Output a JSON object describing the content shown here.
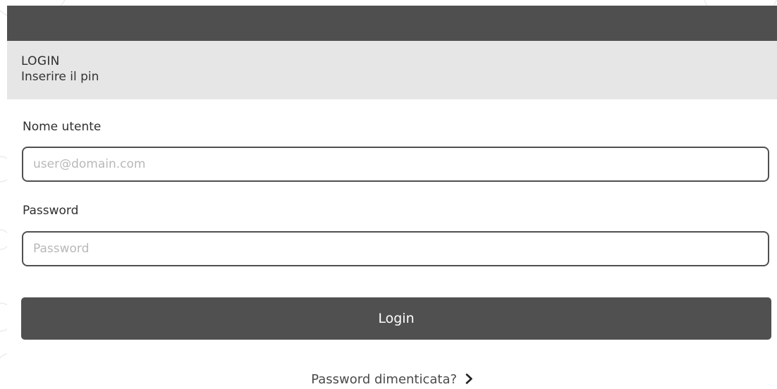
{
  "header": {
    "title": "LOGIN",
    "subtitle": "Inserire il pin"
  },
  "form": {
    "username_label": "Nome utente",
    "username_placeholder": "user@domain.com",
    "username_value": "",
    "password_label": "Password",
    "password_placeholder": "Password",
    "password_value": "",
    "submit_label": "Login",
    "forgot_label": "Password dimenticata?"
  },
  "colors": {
    "topbar": "#4f4f4f",
    "header_bg": "#e6e6e6",
    "button_bg": "#505050",
    "input_border": "#505050"
  },
  "icons": {
    "forgot_link_icon": "chevron-right-icon"
  }
}
